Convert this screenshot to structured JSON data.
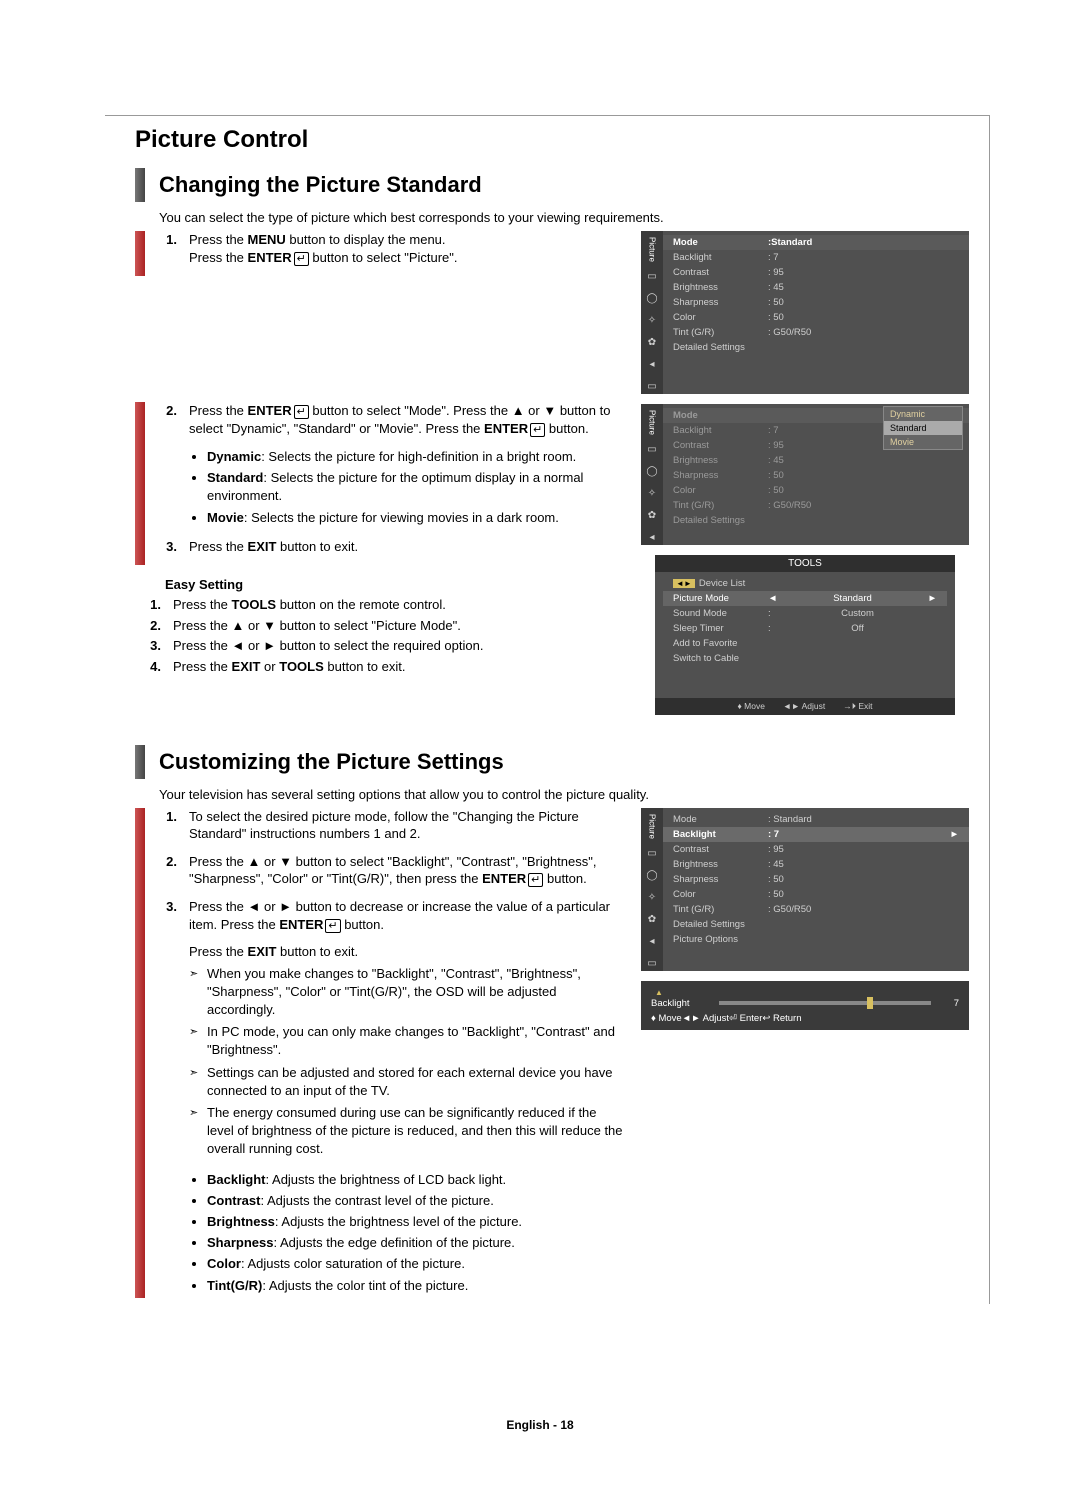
{
  "header": {
    "title": "Picture Control"
  },
  "section1": {
    "title": "Changing the Picture Standard",
    "intro": "You can select the type of picture which best corresponds to your viewing requirements.",
    "steps": [
      {
        "n": "1.",
        "text": "Press the MENU button to display the menu.\nPress the ENTER button to select \"Picture\"."
      },
      {
        "n": "2.",
        "text": "Press the ENTER button to select \"Mode\". Press the ▲ or ▼ button to select \"Dynamic\", \"Standard\" or \"Movie\". Press the ENTER button."
      }
    ],
    "modes": [
      {
        "name": "Dynamic",
        "desc": ": Selects the picture for high-definition in a bright room."
      },
      {
        "name": "Standard",
        "desc": ": Selects the picture for the optimum display in a normal environment."
      },
      {
        "name": "Movie",
        "desc": ": Selects the picture for viewing movies in a dark room."
      }
    ],
    "step3": {
      "n": "3.",
      "text": "Press the EXIT button to exit."
    },
    "easy": {
      "title": "Easy Setting",
      "steps": [
        {
          "n": "1.",
          "text": "Press the TOOLS button on the remote control."
        },
        {
          "n": "2.",
          "text": "Press the ▲ or ▼ button to select \"Picture Mode\"."
        },
        {
          "n": "3.",
          "text": "Press the ◄ or ► button to select the required option."
        },
        {
          "n": "4.",
          "text": "Press the EXIT or TOOLS button to exit."
        }
      ]
    }
  },
  "osd1": {
    "side": "Picture",
    "rows": [
      {
        "k": "Mode",
        "v": ":Standard",
        "hl": true
      },
      {
        "k": "Backlight",
        "v": ": 7"
      },
      {
        "k": "Contrast",
        "v": ": 95"
      },
      {
        "k": "Brightness",
        "v": ": 45"
      },
      {
        "k": "Sharpness",
        "v": ": 50"
      },
      {
        "k": "Color",
        "v": ": 50"
      },
      {
        "k": "Tint (G/R)",
        "v": ": G50/R50"
      },
      {
        "k": "Detailed Settings",
        "v": ""
      }
    ]
  },
  "osd2": {
    "side": "Picture",
    "rows": [
      {
        "k": "Mode",
        "v": ""
      },
      {
        "k": "Backlight",
        "v": ": 7"
      },
      {
        "k": "Contrast",
        "v": ": 95"
      },
      {
        "k": "Brightness",
        "v": ": 45"
      },
      {
        "k": "Sharpness",
        "v": ": 50"
      },
      {
        "k": "Color",
        "v": ": 50"
      },
      {
        "k": "Tint (G/R)",
        "v": ": G50/R50"
      },
      {
        "k": "Detailed Settings",
        "v": ""
      }
    ],
    "popup": [
      "Dynamic",
      "Standard",
      "Movie"
    ],
    "popup_sel": "Standard"
  },
  "osd3": {
    "title": "TOOLS",
    "rows": [
      {
        "k": "Device List",
        "v": ""
      },
      {
        "k": "Picture Mode",
        "v": "Standard",
        "nav": true
      },
      {
        "k": "Sound Mode",
        "c": ":",
        "v": "Custom"
      },
      {
        "k": "Sleep Timer",
        "c": ":",
        "v": "Off"
      },
      {
        "k": "Add to Favorite",
        "v": ""
      },
      {
        "k": "Switch to Cable",
        "v": ""
      }
    ],
    "footer": [
      "♦ Move",
      "◄► Adjust",
      "→⏵ Exit"
    ]
  },
  "section2": {
    "title": "Customizing the Picture Settings",
    "intro": "Your television has several setting options that allow you to control the picture quality.",
    "steps": [
      {
        "n": "1.",
        "text": "To select the desired picture mode, follow the \"Changing the Picture Standard\" instructions numbers 1 and 2."
      },
      {
        "n": "2.",
        "text": "Press the ▲ or ▼ button to select \"Backlight\", \"Contrast\", \"Brightness\", \"Sharpness\", \"Color\" or \"Tint(G/R)\", then press the ENTER button."
      },
      {
        "n": "3.",
        "text": "Press the ◄ or ► button to decrease or increase the value of a particular item. Press the ENTER button."
      }
    ],
    "exit": "Press the EXIT button to exit.",
    "notes": [
      "When you make changes to \"Backlight\", \"Contrast\", \"Brightness\", \"Sharpness\", \"Color\" or \"Tint(G/R)\", the OSD will be adjusted accordingly.",
      "In PC mode, you can only make changes to \"Backlight\", \"Contrast\" and \"Brightness\".",
      "Settings can be adjusted and stored for each external device you have connected to an input of the TV.",
      "The energy consumed during use can be significantly reduced if the level of brightness of the picture is reduced, and then this will reduce the overall running cost."
    ],
    "defs": [
      {
        "name": "Backlight",
        "desc": ": Adjusts the brightness of LCD back light."
      },
      {
        "name": "Contrast",
        "desc": ": Adjusts the contrast level of the picture."
      },
      {
        "name": "Brightness",
        "desc": ": Adjusts the brightness level of the picture."
      },
      {
        "name": "Sharpness",
        "desc": ": Adjusts the edge definition of the picture."
      },
      {
        "name": "Color",
        "desc": ": Adjusts color saturation of the picture."
      },
      {
        "name": "Tint(G/R)",
        "desc": ": Adjusts the color tint of the picture."
      }
    ]
  },
  "osd4": {
    "side": "Picture",
    "rows": [
      {
        "k": "Mode",
        "v": ": Standard"
      },
      {
        "k": "Backlight",
        "v": ": 7",
        "sel": true
      },
      {
        "k": "Contrast",
        "v": ": 95"
      },
      {
        "k": "Brightness",
        "v": ": 45"
      },
      {
        "k": "Sharpness",
        "v": ": 50"
      },
      {
        "k": "Color",
        "v": ": 50"
      },
      {
        "k": "Tint (G/R)",
        "v": ": G50/R50"
      },
      {
        "k": "Detailed Settings",
        "v": ""
      },
      {
        "k": "Picture Options",
        "v": ""
      }
    ]
  },
  "slider": {
    "label": "Backlight",
    "val": "7",
    "footer": [
      "♦ Move",
      "◄► Adjust",
      "⏎ Enter",
      "↩ Return"
    ]
  },
  "footer": {
    "text": "English - 18"
  }
}
